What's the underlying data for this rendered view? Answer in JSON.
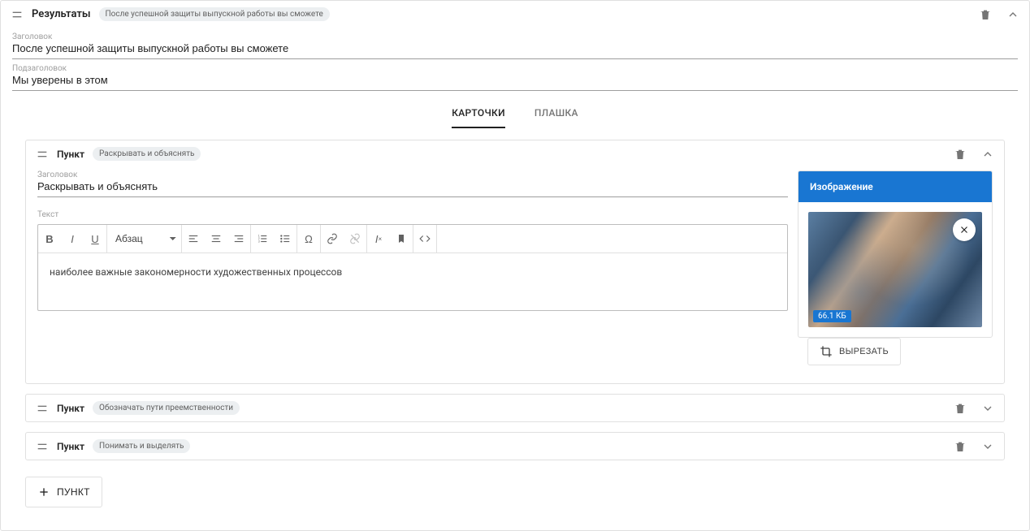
{
  "section": {
    "title": "Результаты",
    "pill": "После успешной защиты выпускной работы вы сможете",
    "heading_label": "Заголовок",
    "heading_value": "После успешной защиты выпускной работы вы сможете",
    "subheading_label": "Подзаголовок",
    "subheading_value": "Мы уверены в этом"
  },
  "tabs": {
    "cards": "КАРТОЧКИ",
    "plate": "ПЛАШКА"
  },
  "card": {
    "label": "Пункт",
    "pill": "Раскрывать и объяснять",
    "heading_label": "Заголовок",
    "heading_value": "Раскрывать и объяснять",
    "text_label": "Текст",
    "para_option": "Абзац",
    "rte_content": "наиболее важные закономерности художественных процессов"
  },
  "image": {
    "title": "Изображение",
    "size": "66.1 КБ",
    "crop": "ВЫРЕЗАТЬ"
  },
  "rows": [
    {
      "label": "Пункт",
      "pill": "Обозначать пути преемственности"
    },
    {
      "label": "Пункт",
      "pill": "Понимать и выделять"
    }
  ],
  "add": "ПУНКТ"
}
